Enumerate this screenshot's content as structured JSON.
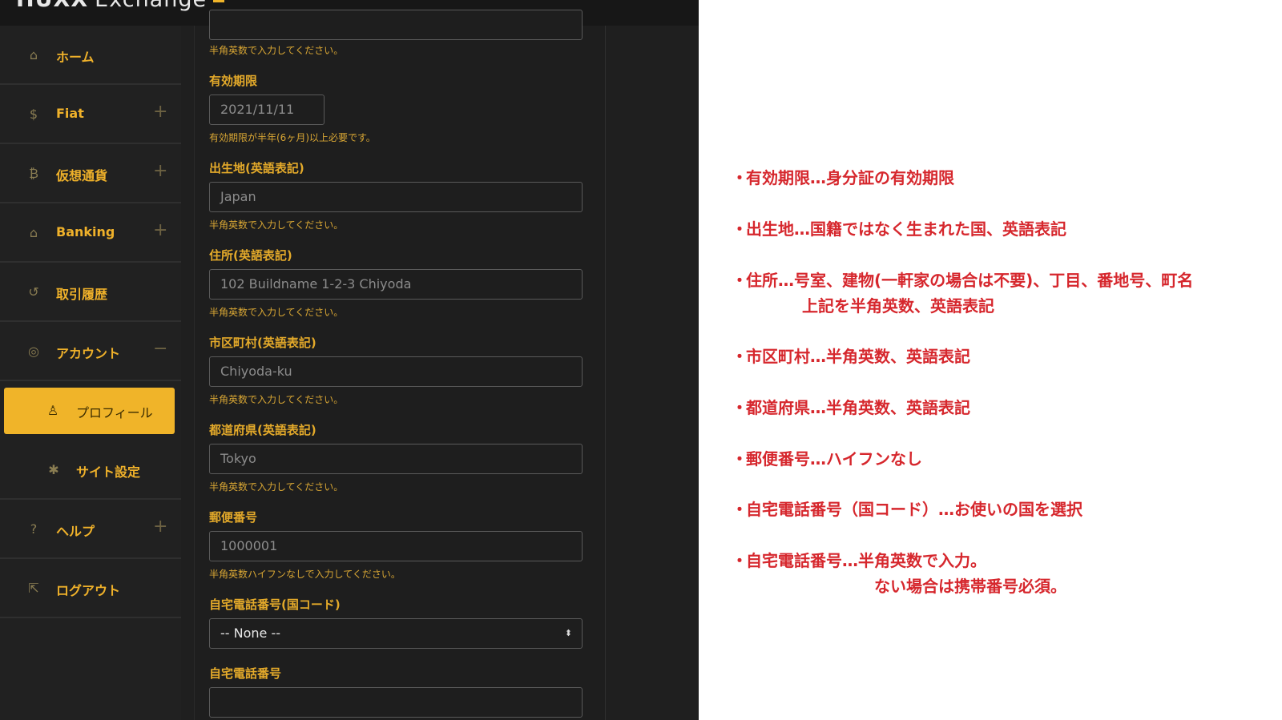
{
  "app": {
    "logo_bold": "HUXX",
    "logo_rest": "Exchange"
  },
  "sidebar": {
    "items": [
      {
        "name": "home",
        "icon": "home-icon",
        "glyph": "⌂",
        "label": "ホーム",
        "expand": ""
      },
      {
        "name": "fiat",
        "icon": "dollar-icon",
        "glyph": "$",
        "label": "Fiat",
        "expand": "+"
      },
      {
        "name": "crypto",
        "icon": "bitcoin-icon",
        "glyph": "₿",
        "label": "仮想通貨",
        "expand": "+"
      },
      {
        "name": "banking",
        "icon": "bank-icon",
        "glyph": "⌂",
        "label": "Banking",
        "expand": "+"
      },
      {
        "name": "history",
        "icon": "history-icon",
        "glyph": "↺",
        "label": "取引履歴",
        "expand": ""
      },
      {
        "name": "account",
        "icon": "user-circle-icon",
        "glyph": "◎",
        "label": "アカウント",
        "expand": "−"
      },
      {
        "name": "profile",
        "icon": "user-icon",
        "glyph": "♙",
        "label": "プロフィール",
        "expand": ""
      },
      {
        "name": "site-settings",
        "icon": "gear-icon",
        "glyph": "✱",
        "label": "サイト設定",
        "expand": ""
      },
      {
        "name": "help",
        "icon": "help-icon",
        "glyph": "?",
        "label": "ヘルプ",
        "expand": "+"
      },
      {
        "name": "logout",
        "icon": "logout-icon",
        "glyph": "⇱",
        "label": "ログアウト",
        "expand": ""
      }
    ]
  },
  "form": {
    "prev_hint": "半角英数で入力してください。",
    "expiry": {
      "label": "有効期限",
      "value": "2021/11/11",
      "hint": "有効期限が半年(6ヶ月)以上必要です。"
    },
    "birthplace": {
      "label": "出生地(英語表記)",
      "value": "Japan",
      "hint": "半角英数で入力してください。"
    },
    "address": {
      "label": "住所(英語表記)",
      "value": "102 Buildname 1-2-3 Chiyoda",
      "hint": "半角英数で入力してください。"
    },
    "city": {
      "label": "市区町村(英語表記)",
      "value": "Chiyoda-ku",
      "hint": "半角英数で入力してください。"
    },
    "prefecture": {
      "label": "都道府県(英語表記)",
      "value": "Tokyo",
      "hint": "半角英数で入力してください。"
    },
    "postal": {
      "label": "郵便番号",
      "value": "1000001",
      "hint": "半角英数ハイフンなしで入力してください。"
    },
    "phone_country": {
      "label": "自宅電話番号(国コード)",
      "value": "-- None --"
    },
    "phone": {
      "label": "自宅電話番号",
      "value": ""
    }
  },
  "notes": {
    "bullet": "・",
    "expiry": "有効期限…身分証の有効期限",
    "birthplace": "出生地…国籍ではなく生まれた国、英語表記",
    "address_1": "住所…号室、建物(一軒家の場合は不要)、丁目、番地号、町名",
    "address_2": "上記を半角英数、英語表記",
    "city": "市区町村…半角英数、英語表記",
    "prefecture": "都道府県…半角英数、英語表記",
    "postal": "郵便番号…ハイフンなし",
    "phone_country": "自宅電話番号（国コード）…お使いの国を選択",
    "phone_1": "自宅電話番号…半角英数で入力。",
    "phone_2": "ない場合は携帯番号必須。"
  }
}
